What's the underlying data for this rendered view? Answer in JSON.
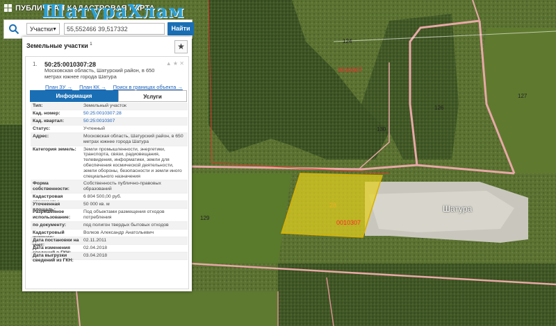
{
  "app": {
    "title": "ПУБЛИЧНАЯ КАДАСТРОВАЯ КАРТА",
    "watermark": "ШатураХлам"
  },
  "search": {
    "type_selected": "Участки",
    "query": "55,552466 39,517332",
    "find_label": "Найти"
  },
  "panel": {
    "title": "Земельные участки",
    "count": "1",
    "favorite_glyph": "★"
  },
  "card": {
    "index": "1.",
    "cad_number": "50:25:0010307:28",
    "address": "Московская область, Шатурский район, в 650 метрах южнее города Шатура",
    "links": [
      "План ЗУ →",
      "План КК →",
      "Поиск в границах объекта →"
    ],
    "tabs": [
      {
        "label": "Информация",
        "active": true
      },
      {
        "label": "Услуги",
        "active": false
      }
    ],
    "info": [
      {
        "k": "Тип:",
        "v": "Земельный участок"
      },
      {
        "k": "Кад. номер:",
        "v": "50:25:0010307:28",
        "link": true
      },
      {
        "k": "Кад. квартал:",
        "v": "50:25:0010307",
        "link": true
      },
      {
        "k": "Статус:",
        "v": "Учтенный"
      },
      {
        "k": "Адрес:",
        "v": "Московская область, Шатурский район, в 650 метрах южнее города Шатура"
      },
      {
        "k": "Категория земель:",
        "v": "Земли промышленности, энергетики, транспорта, связи, радиовещания, телевидения, информатики, земли для обеспечения космической деятельности, земли обороны, безопасности и земли иного специального назначения"
      },
      {
        "k": "Форма собственности:",
        "v": "Собственность публично-правовых образований"
      },
      {
        "k": "Кадастровая стоимость:",
        "v": "6 804 500,00 руб."
      },
      {
        "k": "Уточненная площадь:",
        "v": "50 000 кв. м"
      },
      {
        "k": "Разрешенное использование:",
        "v": "Под объектами размещения отходов потребления"
      },
      {
        "k": "по документу:",
        "v": "под полигон твердых бытовых отходов"
      },
      {
        "k": "Кадастровый инженер:",
        "v": "Волков Александр Анатольевич"
      },
      {
        "k": "Дата постановки на учет:",
        "v": "02.11.2011"
      },
      {
        "k": "Дата изменения сведений в ГКН:",
        "v": "02.04.2018"
      },
      {
        "k": "Дата выгрузки сведений из ГКН:",
        "v": "03.04.2018"
      }
    ]
  },
  "map": {
    "labels": {
      "quarter_a": "0010307",
      "quarter_b": "0010307",
      "parcel_num": "28",
      "town": "Шатура",
      "road_124": "124",
      "road_127": "127",
      "road_126": "126",
      "road_130": "130",
      "road_129": "129"
    }
  },
  "colors": {
    "accent": "#1a6fb4",
    "parcel_fill": "#e6d21e",
    "road": "#e8a8a8",
    "quarter": "#ff2a2a"
  }
}
